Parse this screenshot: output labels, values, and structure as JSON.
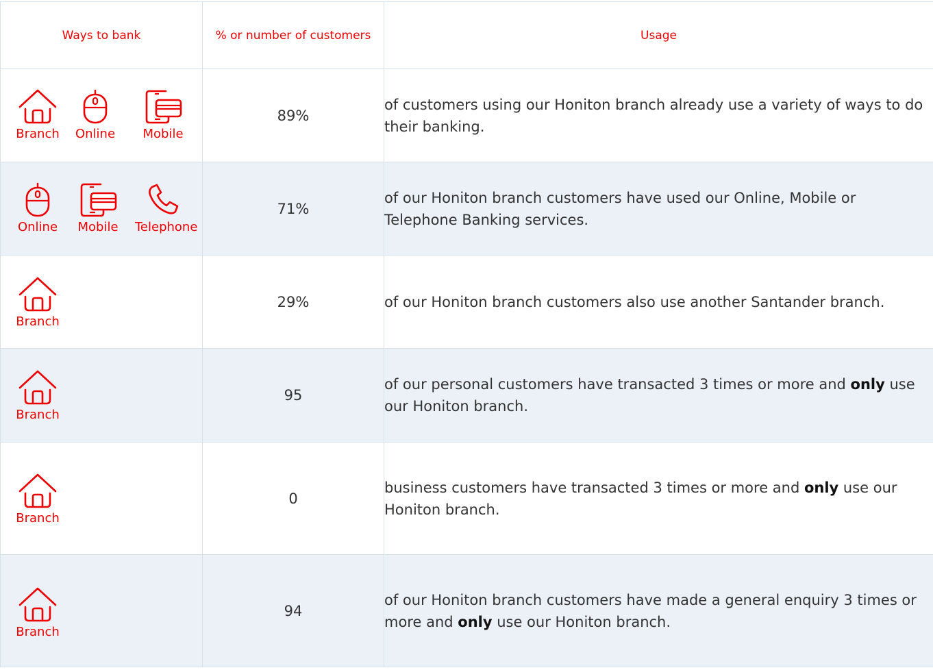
{
  "header": {
    "ways": "Ways to bank",
    "count": "% or number of customers",
    "usage": "Usage"
  },
  "rows": [
    {
      "channels": [
        {
          "label": "Branch",
          "icon": "branch-icon"
        },
        {
          "label": "Online",
          "icon": "mouse-icon"
        },
        {
          "label": "Mobile",
          "icon": "mobile-icon"
        }
      ],
      "value": "89%",
      "usage": {
        "before": "of customers using our Honiton branch already use a variety of ways to do their banking.",
        "bold": "",
        "after": ""
      }
    },
    {
      "channels": [
        {
          "label": "Online",
          "icon": "mouse-icon"
        },
        {
          "label": "Mobile",
          "icon": "mobile-icon"
        },
        {
          "label": "Telephone",
          "icon": "telephone-icon"
        }
      ],
      "value": "71%",
      "usage": {
        "before": "of our Honiton branch customers have used our Online, Mobile or Telephone Banking services.",
        "bold": "",
        "after": ""
      }
    },
    {
      "channels": [
        {
          "label": "Branch",
          "icon": "branch-icon"
        }
      ],
      "value": "29%",
      "usage": {
        "before": "of our Honiton branch customers also use another Santander branch.",
        "bold": "",
        "after": ""
      }
    },
    {
      "channels": [
        {
          "label": "Branch",
          "icon": "branch-icon"
        }
      ],
      "value": "95",
      "usage": {
        "before": "of our personal customers have transacted 3 times or more and ",
        "bold": "only",
        "after": " use our Honiton branch."
      }
    },
    {
      "channels": [
        {
          "label": "Branch",
          "icon": "branch-icon"
        }
      ],
      "value": "0",
      "usage": {
        "before": "business customers have transacted 3 times or more and ",
        "bold": "only",
        "after": " use our Honiton branch."
      }
    },
    {
      "channels": [
        {
          "label": "Branch",
          "icon": "branch-icon"
        }
      ],
      "value": "94",
      "usage": {
        "before": "of our Honiton branch customers have made a general enquiry 3 times or more and ",
        "bold": "only",
        "after": " use our Honiton branch."
      }
    }
  ],
  "colors": {
    "accent": "#ec0000",
    "row_alt": "#ebf1f7",
    "border": "#d6e1ec",
    "text": "#333333"
  }
}
